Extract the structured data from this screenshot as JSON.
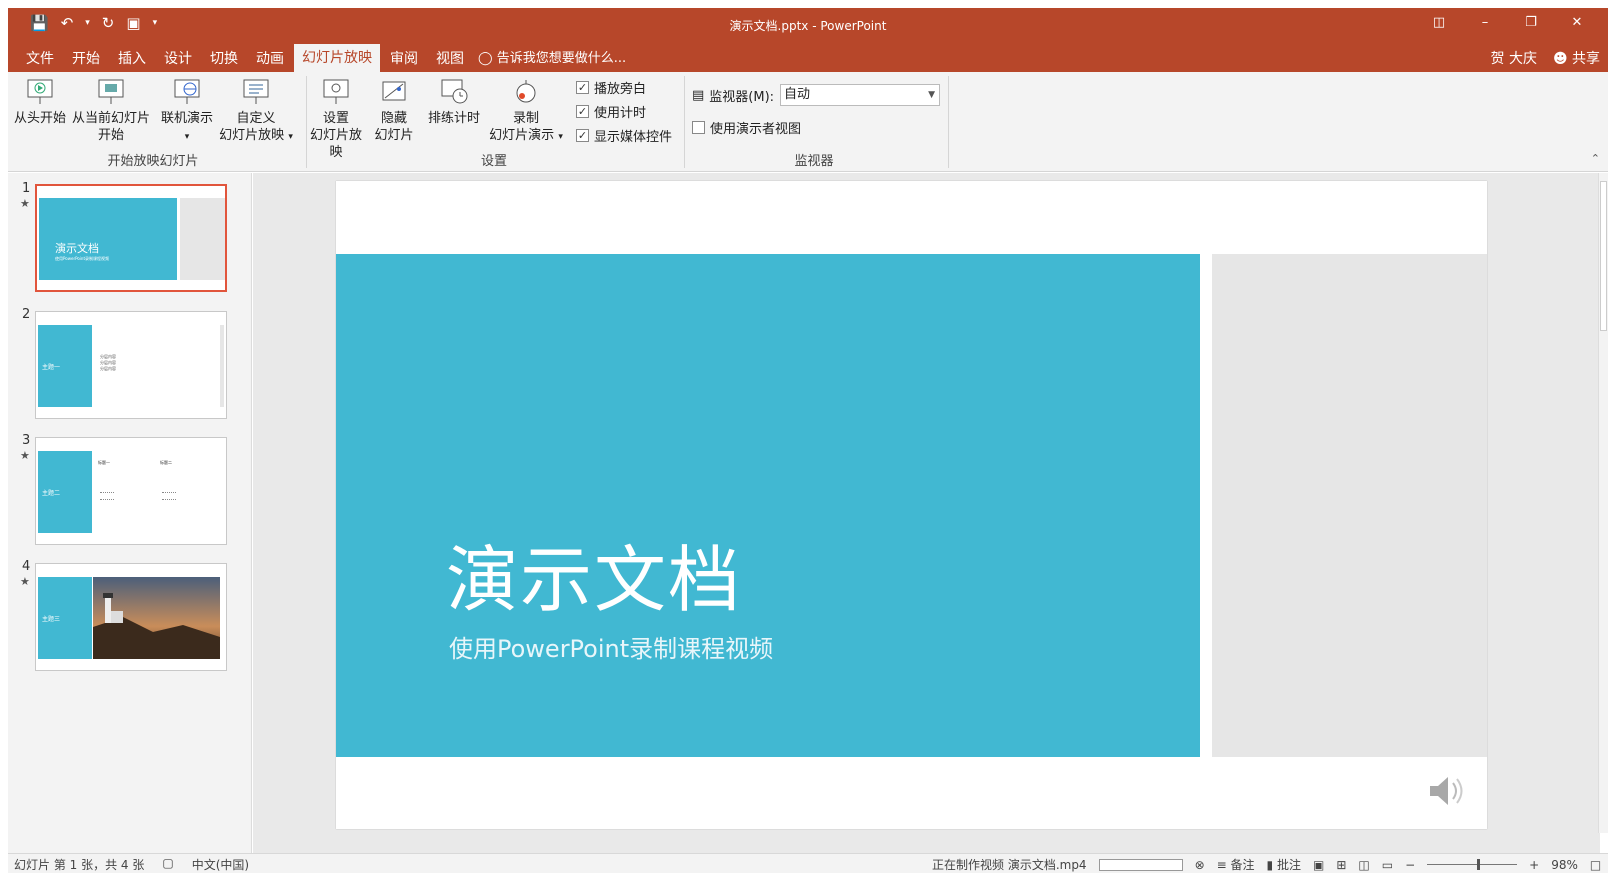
{
  "app": {
    "window_title": "演示文档.pptx - PowerPoint",
    "qat_icons": [
      "save-icon",
      "undo-icon",
      "redo-icon",
      "presentation-icon",
      "customize-icon"
    ]
  },
  "menu": {
    "tabs": [
      "文件",
      "开始",
      "插入",
      "设计",
      "切换",
      "动画",
      "幻灯片放映",
      "审阅",
      "视图"
    ],
    "active_tab": "幻灯片放映",
    "tell_me": "告诉我您想要做什么...",
    "user_name": "贺 大庆",
    "share": "共享"
  },
  "ribbon": {
    "start_group": {
      "label": "开始放映幻灯片",
      "from_beginning": "从头开始",
      "from_current_line1": "从当前幻灯片",
      "from_current_line2": "开始",
      "online": "联机演示",
      "custom_line1": "自定义",
      "custom_line2": "幻灯片放映"
    },
    "setup_group": {
      "label": "设置",
      "setup_line1": "设置",
      "setup_line2": "幻灯片放映",
      "hide_line1": "隐藏",
      "hide_line2": "幻灯片",
      "rehearse": "排练计时",
      "record_line1": "录制",
      "record_line2": "幻灯片演示",
      "play_narrations": "播放旁白",
      "use_timings": "使用计时",
      "show_media_controls": "显示媒体控件"
    },
    "monitor_group": {
      "label": "监视器",
      "monitor_label": "监视器(M):",
      "monitor_value": "自动",
      "presenter_view": "使用演示者视图"
    }
  },
  "slides": [
    {
      "num": "1",
      "title": "演示文档",
      "subtitle": "使用PowerPoint录制课程视频"
    },
    {
      "num": "2",
      "title": "主题一",
      "items": [
        "分层内容",
        "分层内容",
        "分层内容"
      ]
    },
    {
      "num": "3",
      "title": "主题二",
      "col1": "标题一",
      "col2": "标题二"
    },
    {
      "num": "4",
      "title": "主题三"
    }
  ],
  "main_slide": {
    "title": "演示文档",
    "subtitle": "使用PowerPoint录制课程视频"
  },
  "status": {
    "slide_info": "幻灯片 第 1 张，共 4 张",
    "language": "中文(中国)",
    "export_status": "正在制作视频 演示文档.mp4",
    "notes": "备注",
    "comments": "批注",
    "zoom": "98%"
  },
  "colors": {
    "accent": "#b7472a",
    "slide_blue": "#41b8d2",
    "slide_grey": "#e6e6e6",
    "ribbon_bg": "#f3f3f3"
  }
}
